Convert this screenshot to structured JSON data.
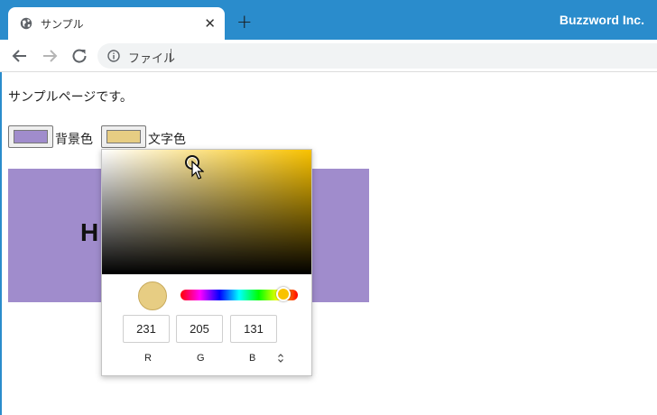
{
  "browser": {
    "tab_title": "サンプル",
    "tab_close": "✕",
    "new_tab": "+",
    "brand": "Buzzword Inc.",
    "address_text": "ファイル",
    "icons": [
      "globe-icon",
      "back-icon",
      "forward-icon",
      "reload-icon",
      "info-icon"
    ]
  },
  "page": {
    "text": "サンプルページです。",
    "bg_label": "背景色",
    "text_label": "文字色",
    "heading": "H",
    "bg_color": "#a08ccc",
    "text_color": "#e7cd83"
  },
  "picker": {
    "hue_color": "#f9c200",
    "r_value": "231",
    "g_value": "205",
    "b_value": "131",
    "r_label": "R",
    "g_label": "G",
    "b_label": "B"
  },
  "colors": {
    "titlebar": "#2a8ccc",
    "accent": "#2a8ccc"
  }
}
